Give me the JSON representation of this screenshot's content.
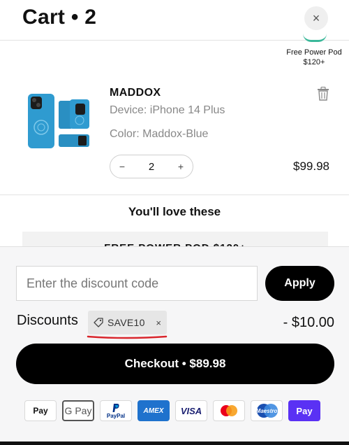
{
  "header": {
    "title": "Cart • 2",
    "close_glyph": "×"
  },
  "reward": {
    "label": "Free Power Pod",
    "threshold": "$120+"
  },
  "cart_item": {
    "name": "MADDOX",
    "device": "Device: iPhone 14 Plus",
    "color": "Color: Maddox-Blue",
    "quantity": "2",
    "minus": "−",
    "plus": "+",
    "price": "$99.98",
    "image_icon": "blue-phone-wallet-case",
    "image_color": "#2f9bd0"
  },
  "recommendations": {
    "heading": "You'll love these",
    "promo_text": "FREE POWER POD $120+"
  },
  "discount": {
    "placeholder": "Enter the discount code",
    "apply_label": "Apply",
    "label": "Discounts",
    "code": "SAVE10",
    "remove_glyph": "×",
    "amount": "- $10.00"
  },
  "checkout": {
    "label": "Checkout • $89.98"
  },
  "payment_methods": [
    {
      "name": "apple-pay",
      "label": " Pay"
    },
    {
      "name": "google-pay",
      "label": "G Pay"
    },
    {
      "name": "paypal",
      "label": "PayPal"
    },
    {
      "name": "amex",
      "label": "AMEX"
    },
    {
      "name": "visa",
      "label": "VISA"
    },
    {
      "name": "mastercard",
      "label": ""
    },
    {
      "name": "maestro",
      "label": "Maestro"
    },
    {
      "name": "shop-pay",
      "label": "Pay"
    }
  ],
  "colors": {
    "accent_black": "#000000",
    "reward_green": "#3bb89a",
    "underline_red": "#d9262c"
  }
}
